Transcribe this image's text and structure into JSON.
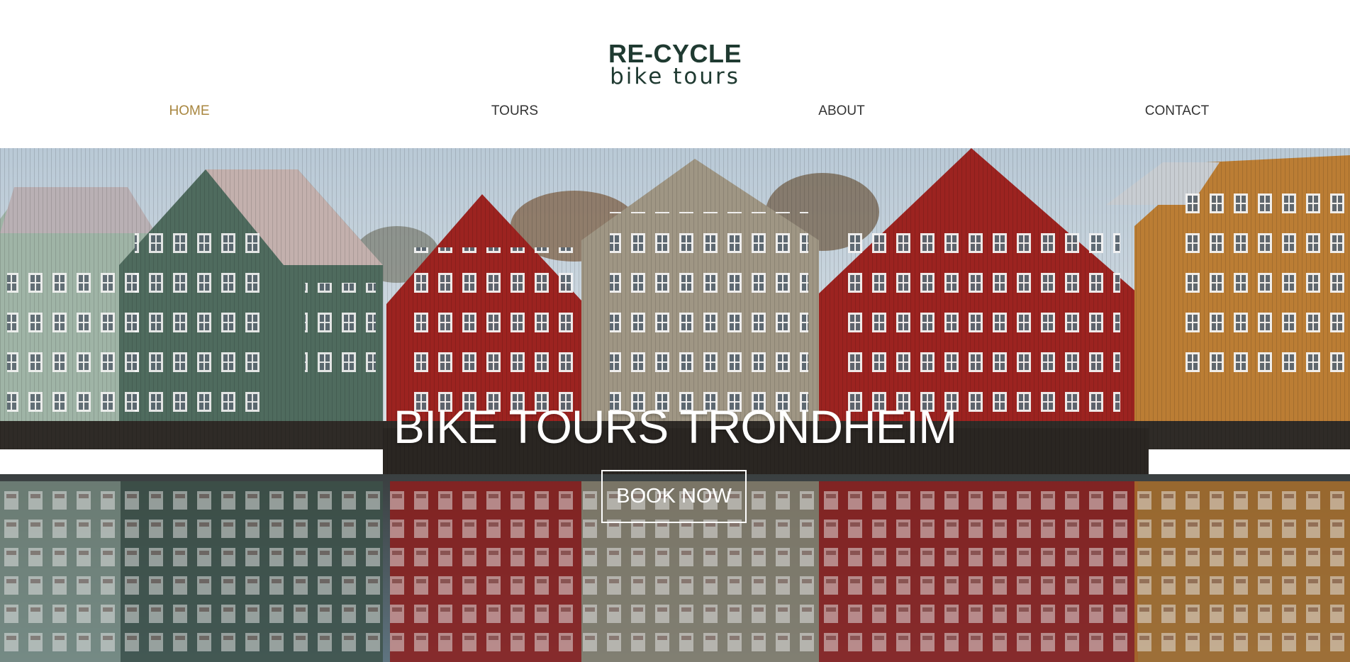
{
  "brand": {
    "line1": "RE-CYCLE",
    "line2": "bike tours",
    "color": "#1f3a31"
  },
  "nav": {
    "active_color": "#a8863f",
    "items": [
      {
        "label": "HOME",
        "active": true
      },
      {
        "label": "TOURS",
        "active": false
      },
      {
        "label": "ABOUT",
        "active": false
      },
      {
        "label": "CONTACT",
        "active": false
      }
    ]
  },
  "hero": {
    "title": "BIKE TOURS TRONDHEIM",
    "cta_label": "BOOK NOW",
    "image_subject": "colorful wooden wharf houses reflected in river",
    "colors": {
      "sky": "#c9d6df",
      "mint_house": "#9fb4a6",
      "green_house": "#4f6b5e",
      "red_house": "#9c2320",
      "grey_house": "#9f9684",
      "ochre_house": "#bb7d34",
      "water": "#4c5a60"
    }
  }
}
